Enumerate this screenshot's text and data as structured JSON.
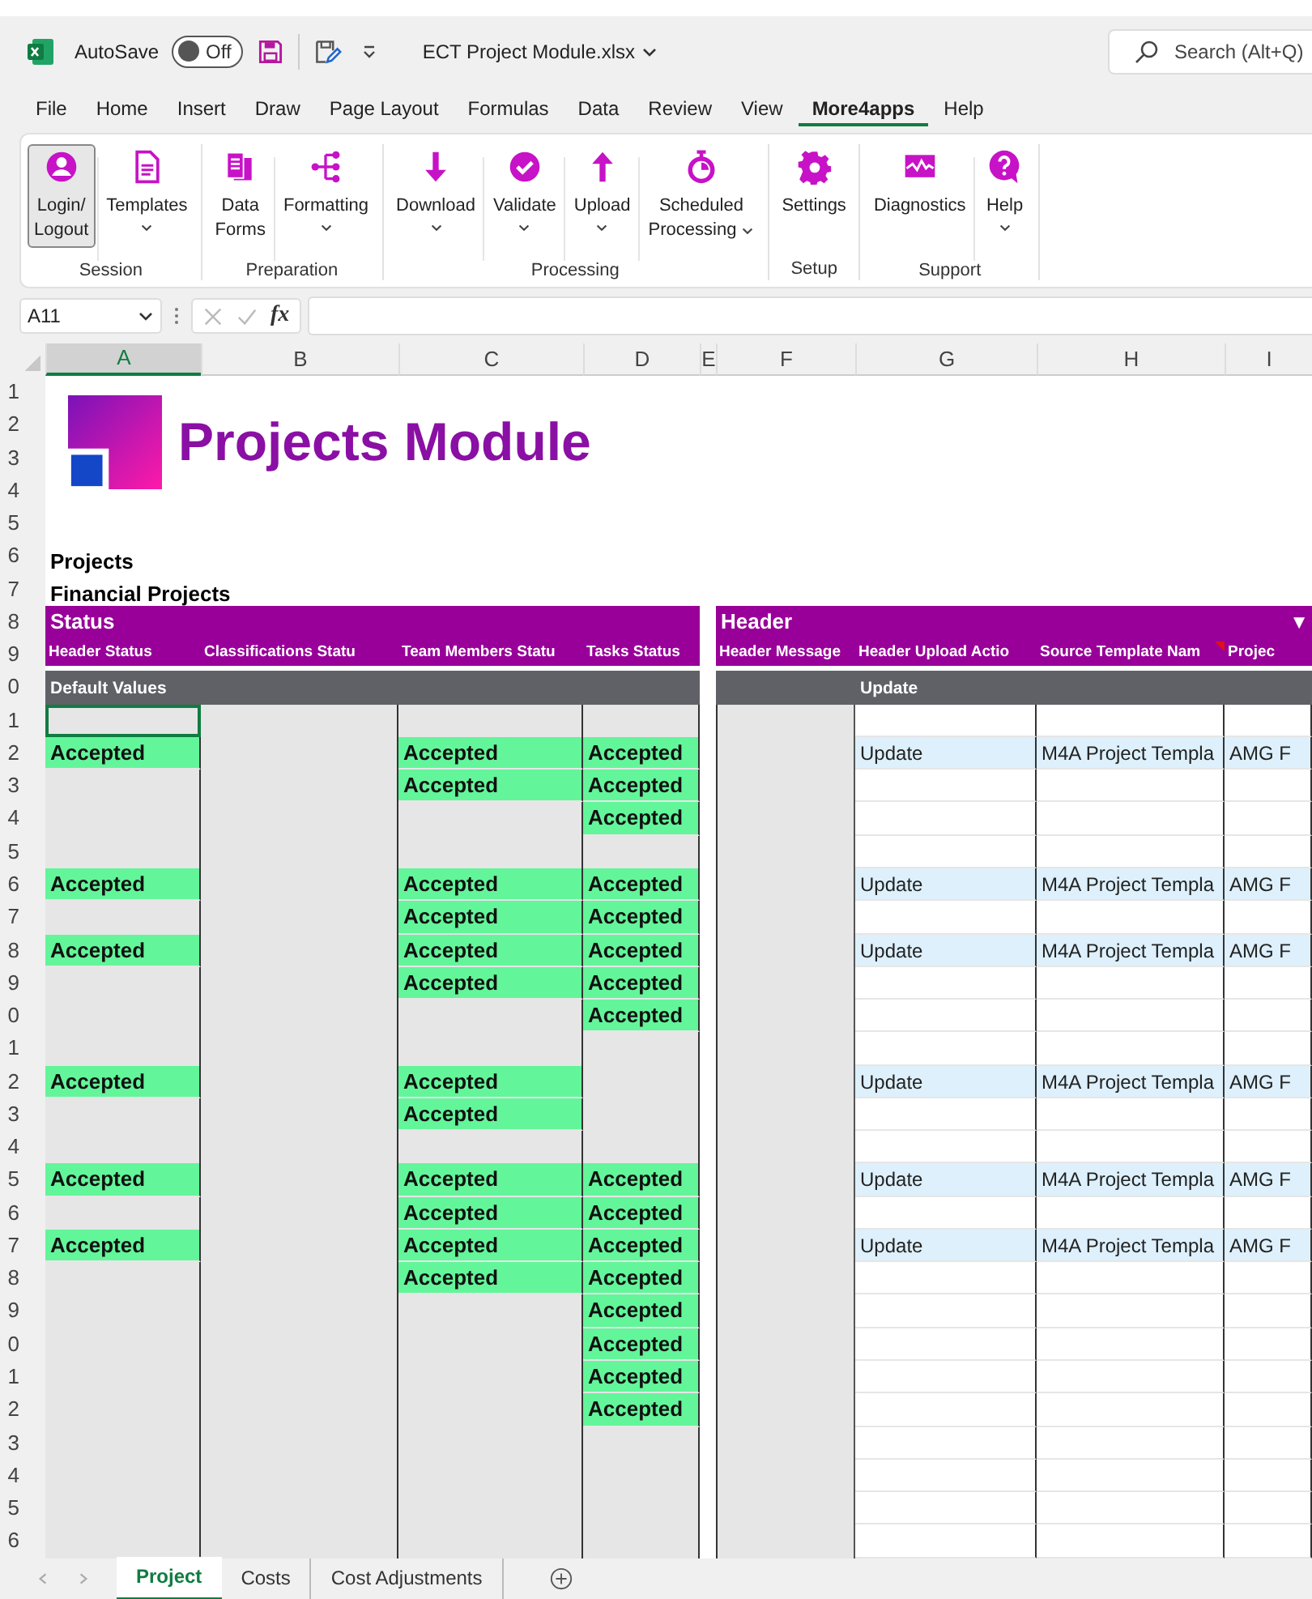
{
  "title_bar": {
    "autosave_label": "AutoSave",
    "autosave": {
      "on": false,
      "label": "Off"
    },
    "file_name": "ECT Project Module.xlsx",
    "search": {
      "placeholder": "Search (Alt+Q)"
    }
  },
  "menu": [
    {
      "label": "File",
      "selected": false
    },
    {
      "label": "Home",
      "selected": false
    },
    {
      "label": "Insert",
      "selected": false
    },
    {
      "label": "Draw",
      "selected": false
    },
    {
      "label": "Page Layout",
      "selected": false
    },
    {
      "label": "Formulas",
      "selected": false
    },
    {
      "label": "Data",
      "selected": false
    },
    {
      "label": "Review",
      "selected": false
    },
    {
      "label": "View",
      "selected": false
    },
    {
      "label": "More4apps",
      "selected": true
    },
    {
      "label": "Help",
      "selected": false
    }
  ],
  "ribbon": [
    {
      "group": "Session",
      "buttons": [
        {
          "lines": [
            "Login/",
            "Logout"
          ],
          "dropdown": false,
          "selected": true
        },
        {
          "lines": [
            "Templates"
          ],
          "dropdown": true,
          "selected": false
        }
      ]
    },
    {
      "group": "Preparation",
      "buttons": [
        {
          "lines": [
            "Data",
            "Forms"
          ],
          "dropdown": false,
          "selected": false
        },
        {
          "lines": [
            "Formatting"
          ],
          "dropdown": true,
          "selected": false
        }
      ]
    },
    {
      "group": "Processing",
      "buttons": [
        {
          "lines": [
            "Download"
          ],
          "dropdown": true,
          "selected": false
        },
        {
          "lines": [
            "Validate"
          ],
          "dropdown": true,
          "selected": false
        },
        {
          "lines": [
            "Upload"
          ],
          "dropdown": true,
          "selected": false
        },
        {
          "lines": [
            "Scheduled",
            "Processing"
          ],
          "dropdown": true,
          "selected": false
        }
      ]
    },
    {
      "group": "Setup",
      "buttons": [
        {
          "lines": [
            "Settings"
          ],
          "dropdown": false,
          "selected": false
        }
      ]
    },
    {
      "group": "Support",
      "buttons": [
        {
          "lines": [
            "Diagnostics"
          ],
          "dropdown": false,
          "selected": false
        },
        {
          "lines": [
            "Help"
          ],
          "dropdown": true,
          "selected": false
        }
      ]
    }
  ],
  "formula_bar": {
    "name_box": "A11",
    "fx": "fx"
  },
  "columns": [
    {
      "label": "A",
      "selected": true
    },
    {
      "label": "B",
      "selected": false
    },
    {
      "label": "C",
      "selected": false
    },
    {
      "label": "D",
      "selected": false
    },
    {
      "label": "E",
      "selected": false
    },
    {
      "label": "F",
      "selected": false
    },
    {
      "label": "G",
      "selected": false
    },
    {
      "label": "H",
      "selected": false
    },
    {
      "label": "I",
      "selected": false
    }
  ],
  "sheet": {
    "title": "Projects Module",
    "row_labels": [
      "1",
      "2",
      "3",
      "4",
      "5",
      "6",
      "7",
      "8",
      "9",
      "0",
      "1",
      "2",
      "3",
      "4",
      "5",
      "6",
      "7",
      "8",
      "9",
      "0",
      "1",
      "2",
      "3",
      "4",
      "5",
      "6",
      "7",
      "8",
      "9",
      "0",
      "1",
      "2",
      "3",
      "4",
      "5",
      "6"
    ],
    "section": "Projects",
    "subsection": "Financial Projects",
    "status_band": "Status",
    "header_band": "Header",
    "header_band_arrow": "▼",
    "field_headers": [
      "Header Status",
      "Classifications Statu",
      "Team Members Statu",
      "Tasks Status",
      "Header Message",
      "Header Upload Actio",
      "Source Template Nam",
      "Projec"
    ],
    "default_values_label": "Default Values",
    "default_upload_action": "Update",
    "rows": [
      {
        "selected": true
      },
      {
        "selected": false,
        "header_status": "Accepted",
        "team_members_status": "Accepted",
        "tasks_status": "Accepted",
        "upload_action": "Update",
        "template_name": "M4A Project Templa",
        "project": "AMG F"
      },
      {
        "selected": false,
        "team_members_status": "Accepted",
        "tasks_status": "Accepted"
      },
      {
        "selected": false,
        "tasks_status": "Accepted"
      },
      {
        "selected": false
      },
      {
        "selected": false,
        "header_status": "Accepted",
        "team_members_status": "Accepted",
        "tasks_status": "Accepted",
        "upload_action": "Update",
        "template_name": "M4A Project Templa",
        "project": "AMG F"
      },
      {
        "selected": false,
        "team_members_status": "Accepted",
        "tasks_status": "Accepted"
      },
      {
        "selected": false,
        "header_status": "Accepted",
        "team_members_status": "Accepted",
        "tasks_status": "Accepted",
        "upload_action": "Update",
        "template_name": "M4A Project Templa",
        "project": "AMG F"
      },
      {
        "selected": false,
        "team_members_status": "Accepted",
        "tasks_status": "Accepted"
      },
      {
        "selected": false,
        "tasks_status": "Accepted"
      },
      {
        "selected": false
      },
      {
        "selected": false,
        "header_status": "Accepted",
        "team_members_status": "Accepted",
        "upload_action": "Update",
        "template_name": "M4A Project Templa",
        "project": "AMG F"
      },
      {
        "selected": false,
        "team_members_status": "Accepted"
      },
      {
        "selected": false
      },
      {
        "selected": false,
        "header_status": "Accepted",
        "team_members_status": "Accepted",
        "tasks_status": "Accepted",
        "upload_action": "Update",
        "template_name": "M4A Project Templa",
        "project": "AMG F"
      },
      {
        "selected": false,
        "team_members_status": "Accepted",
        "tasks_status": "Accepted"
      },
      {
        "selected": false,
        "header_status": "Accepted",
        "team_members_status": "Accepted",
        "tasks_status": "Accepted",
        "upload_action": "Update",
        "template_name": "M4A Project Templa",
        "project": "AMG F"
      },
      {
        "selected": false,
        "team_members_status": "Accepted",
        "tasks_status": "Accepted"
      },
      {
        "selected": false,
        "tasks_status": "Accepted"
      },
      {
        "selected": false,
        "tasks_status": "Accepted"
      },
      {
        "selected": false,
        "tasks_status": "Accepted"
      },
      {
        "selected": false,
        "tasks_status": "Accepted"
      },
      {
        "selected": false
      },
      {
        "selected": false
      },
      {
        "selected": false
      },
      {
        "selected": false
      }
    ]
  },
  "sheet_tabs": [
    {
      "label": "Project",
      "selected": true
    },
    {
      "label": "Costs",
      "selected": false
    },
    {
      "label": "Cost Adjustments",
      "selected": false
    }
  ]
}
